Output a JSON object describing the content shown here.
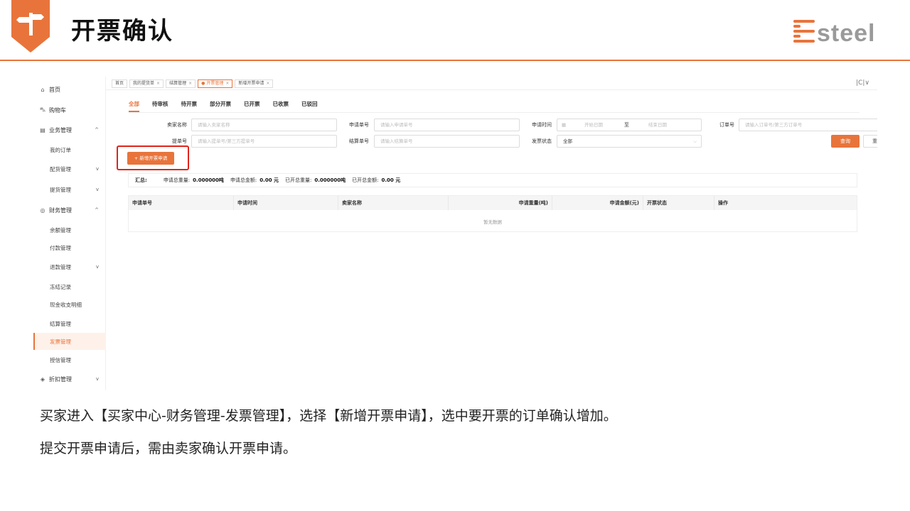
{
  "slide": {
    "title": "开票确认",
    "logo_text": "esteel",
    "accent": "#e8743b",
    "caption_line1": "买家进入【买家中心-财务管理-发票管理】，选择【新增开票申请】，选中要开票的订单确认增加。",
    "caption_line2": "提交开票申请后，需由卖家确认开票申请。"
  },
  "sidebar": {
    "items": [
      {
        "label": "首页",
        "icon": "home-icon",
        "glyph": "⌂"
      },
      {
        "label": "购物车",
        "icon": "cart-icon",
        "glyph": "⛍"
      },
      {
        "label": "业务管理",
        "icon": "business-icon",
        "glyph": "▤",
        "chevron": "^"
      },
      {
        "label": "我的订单"
      },
      {
        "label": "配货管理",
        "chevron": "v"
      },
      {
        "label": "提货管理",
        "chevron": "v"
      },
      {
        "label": "财务管理",
        "icon": "finance-icon",
        "glyph": "◎",
        "chevron": "^"
      },
      {
        "label": "余额管理"
      },
      {
        "label": "付款管理"
      },
      {
        "label": "退款管理",
        "chevron": "v"
      },
      {
        "label": "冻结记录"
      },
      {
        "label": "现金收支明细"
      },
      {
        "label": "结算管理"
      },
      {
        "label": "发票管理"
      },
      {
        "label": "授信管理"
      },
      {
        "label": "折扣管理",
        "icon": "discount-icon",
        "glyph": "◈",
        "chevron": "v"
      }
    ]
  },
  "tabs": {
    "items": [
      "首页",
      "我的提货单",
      "结算管理",
      "开票管理",
      "新增开票申请"
    ],
    "tools": "|C|∨"
  },
  "status_tabs": [
    "全部",
    "待审核",
    "待开票",
    "部分开票",
    "已开票",
    "已收票",
    "已驳回"
  ],
  "filters": {
    "seller_label": "卖家名称",
    "seller_ph": "请输入卖家名称",
    "apply_no_label": "申请单号",
    "apply_no_ph": "请输入申请单号",
    "apply_time_label": "申请时间",
    "start_ph": "开始日期",
    "to": "至",
    "end_ph": "结束日期",
    "order_no_label": "订单号",
    "order_no_ph": "请输入订单号/第三方订单号",
    "bill_no_label": "提单号",
    "bill_no_ph": "请输入提单号/第三方提单号",
    "settle_no_label": "结算单号",
    "settle_no_ph": "请输入结算单号",
    "invoice_status_label": "发票状态",
    "invoice_status_value": "全部"
  },
  "buttons": {
    "add_invoice": "+ 新增开票申请",
    "query": "查询",
    "reset": "重置"
  },
  "summary": {
    "head": "汇总:",
    "apply_weight_label": "申请总重量:",
    "apply_weight": "0.000000吨",
    "apply_amount_label": "申请总金额:",
    "apply_amount": "0.00 元",
    "issued_weight_label": "已开总重量:",
    "issued_weight": "0.000000吨",
    "issued_amount_label": "已开总金额:",
    "issued_amount": "0.00 元"
  },
  "table": {
    "columns": [
      "申请单号",
      "申请时间",
      "卖家名称",
      "申请重量(吨)",
      "申请金额(元)",
      "开票状态",
      "操作"
    ],
    "empty": "暂无数据"
  }
}
